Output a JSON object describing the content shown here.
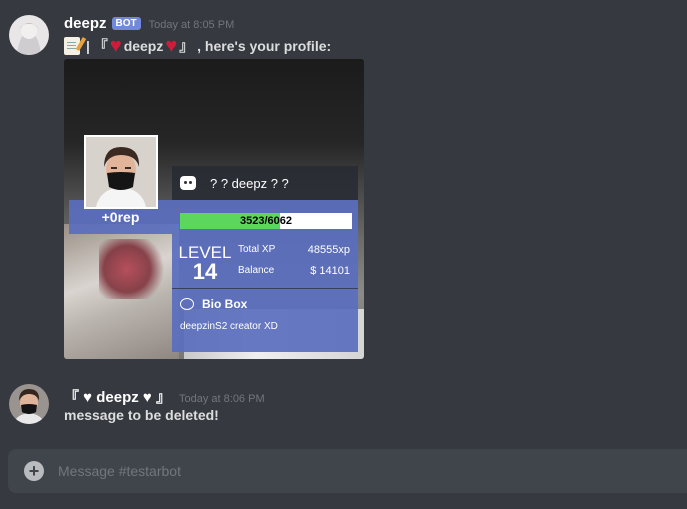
{
  "messages": [
    {
      "author": "deepz",
      "bot_tag": "BOT",
      "timestamp": "Today at 8:05 PM",
      "content": {
        "prefix": "| 『",
        "name": "deepz",
        "suffix": "』 , here's your profile:"
      },
      "profile_card": {
        "rep": "+0rep",
        "display_name": "? ? deepz ? ?",
        "xp_progress": "3523/6062",
        "xp_fraction": 0.581,
        "level_label": "LEVEL",
        "level": "14",
        "total_xp_label": "Total XP",
        "total_xp": "48555xp",
        "balance_label": "Balance",
        "balance": "$ 14101",
        "bio_title": "Bio Box",
        "bio_text": "deepzinS2 creator XD"
      }
    },
    {
      "author": "『 ♥ deepz ♥ 』",
      "timestamp": "Today at 8:06 PM",
      "content": "message to be deleted!"
    }
  ],
  "composer": {
    "placeholder": "Message #testarbot"
  },
  "colors": {
    "background": "#36393f",
    "input": "#40444b",
    "bot_tag": "#7289da",
    "card_panel": "#5a6ebe",
    "xp_fill": "#5cd65c"
  }
}
